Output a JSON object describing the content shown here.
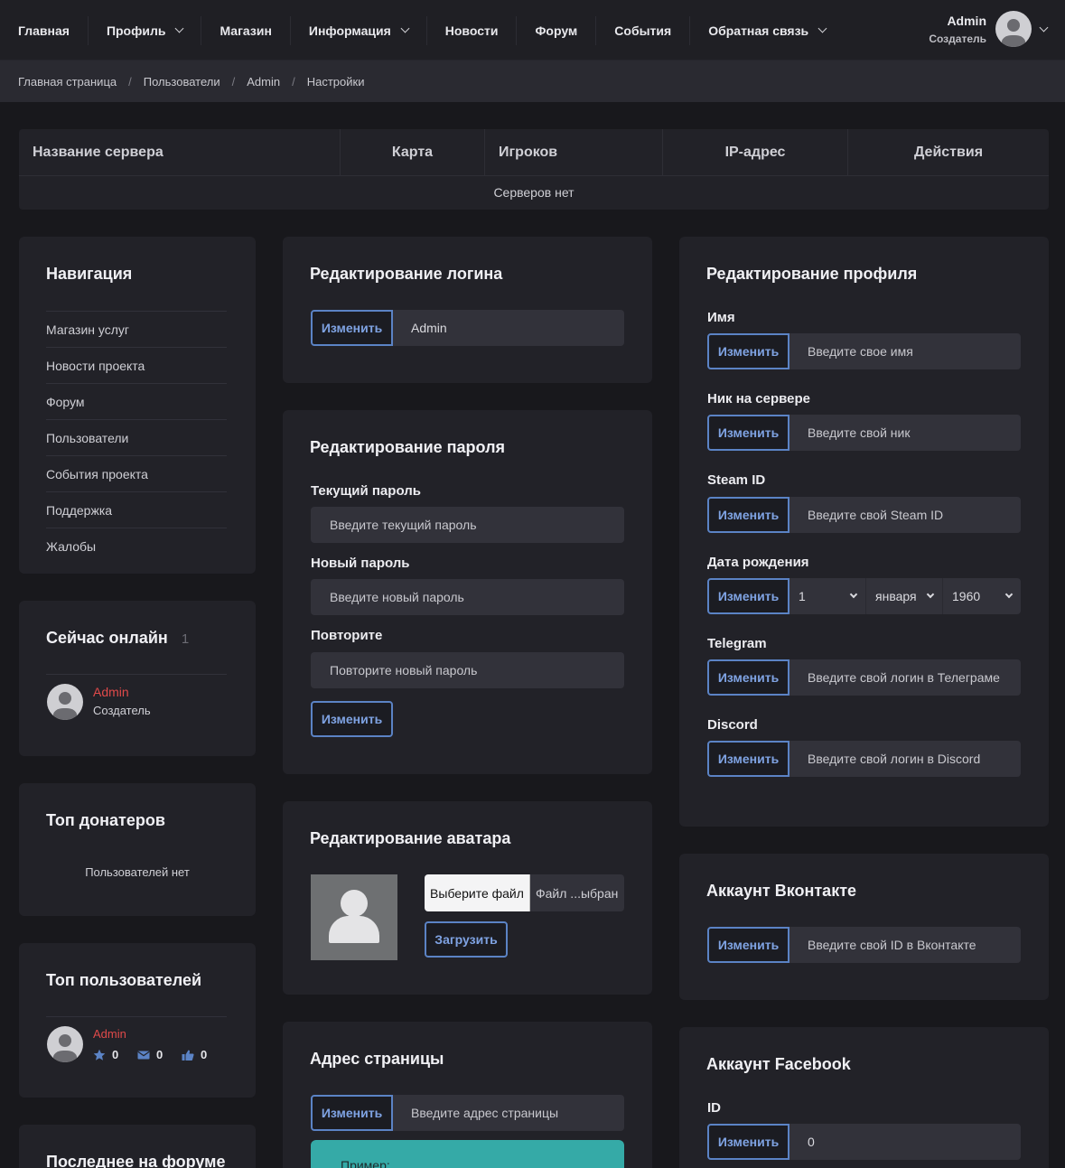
{
  "nav": {
    "items": [
      {
        "label": "Главная",
        "has_dropdown": false
      },
      {
        "label": "Профиль",
        "has_dropdown": true
      },
      {
        "label": "Магазин",
        "has_dropdown": false
      },
      {
        "label": "Информация",
        "has_dropdown": true
      },
      {
        "label": "Новости",
        "has_dropdown": false
      },
      {
        "label": "Форум",
        "has_dropdown": false
      },
      {
        "label": "События",
        "has_dropdown": false
      },
      {
        "label": "Обратная связь",
        "has_dropdown": true
      }
    ],
    "user": {
      "name": "Admin",
      "role": "Создатель"
    }
  },
  "breadcrumbs": [
    "Главная страница",
    "Пользователи",
    "Admin",
    "Настройки"
  ],
  "servers": {
    "headers": [
      "Название сервера",
      "Карта",
      "Игроков",
      "IP-адрес",
      "Действия"
    ],
    "empty_text": "Серверов нет"
  },
  "navigation": {
    "title": "Навигация",
    "items": [
      "Магазин услуг",
      "Новости проекта",
      "Форум",
      "Пользователи",
      "События проекта",
      "Поддержка",
      "Жалобы"
    ]
  },
  "online": {
    "title": "Сейчас онлайн",
    "count": "1",
    "user": {
      "name": "Admin",
      "role": "Создатель"
    }
  },
  "top_donators": {
    "title": "Топ донатеров",
    "empty": "Пользователей нет"
  },
  "top_users": {
    "title": "Топ пользователей",
    "user": {
      "name": "Admin",
      "stars": "0",
      "messages": "0",
      "likes": "0"
    }
  },
  "last_forum": {
    "title": "Последнее на форуме"
  },
  "login_edit": {
    "title": "Редактирование логина",
    "button": "Изменить",
    "value": "Admin"
  },
  "password_edit": {
    "title": "Редактирование пароля",
    "current_label": "Текущий пароль",
    "current_placeholder": "Введите текущий пароль",
    "new_label": "Новый пароль",
    "new_placeholder": "Введите новый пароль",
    "repeat_label": "Повторите",
    "repeat_placeholder": "Повторите новый пароль",
    "button": "Изменить"
  },
  "avatar_edit": {
    "title": "Редактирование аватара",
    "choose_button": "Выберите файл",
    "file_status": "Файл ...ыбран",
    "upload_button": "Загрузить"
  },
  "page_address": {
    "title": "Адрес страницы",
    "button": "Изменить",
    "placeholder": "Введите адрес страницы",
    "example": "Пример:",
    "accent": "#35aaa7"
  },
  "profile_edit": {
    "title": "Редактирование профиля",
    "button": "Изменить",
    "name_label": "Имя",
    "name_placeholder": "Введите свое имя",
    "nick_label": "Ник на сервере",
    "nick_placeholder": "Введите свой ник",
    "steam_label": "Steam ID",
    "steam_placeholder": "Введите свой Steam ID",
    "birth_label": "Дата рождения",
    "birth_day": "1",
    "birth_month": "января",
    "birth_year": "1960",
    "telegram_label": "Telegram",
    "telegram_placeholder": "Введите свой логин в Телеграме",
    "discord_label": "Discord",
    "discord_placeholder": "Введите свой логин в Discord"
  },
  "vk": {
    "title": "Аккаунт Вконтакте",
    "button": "Изменить",
    "placeholder": "Введите свой ID в Вконтакте"
  },
  "facebook": {
    "title": "Аккаунт Facebook",
    "id_label": "ID",
    "button": "Изменить",
    "value": "0"
  },
  "colors": {
    "button_border": "#5b83c5",
    "button_text": "#7fa3e3",
    "online_name": "#e04a4a",
    "card_bg": "#222228"
  }
}
